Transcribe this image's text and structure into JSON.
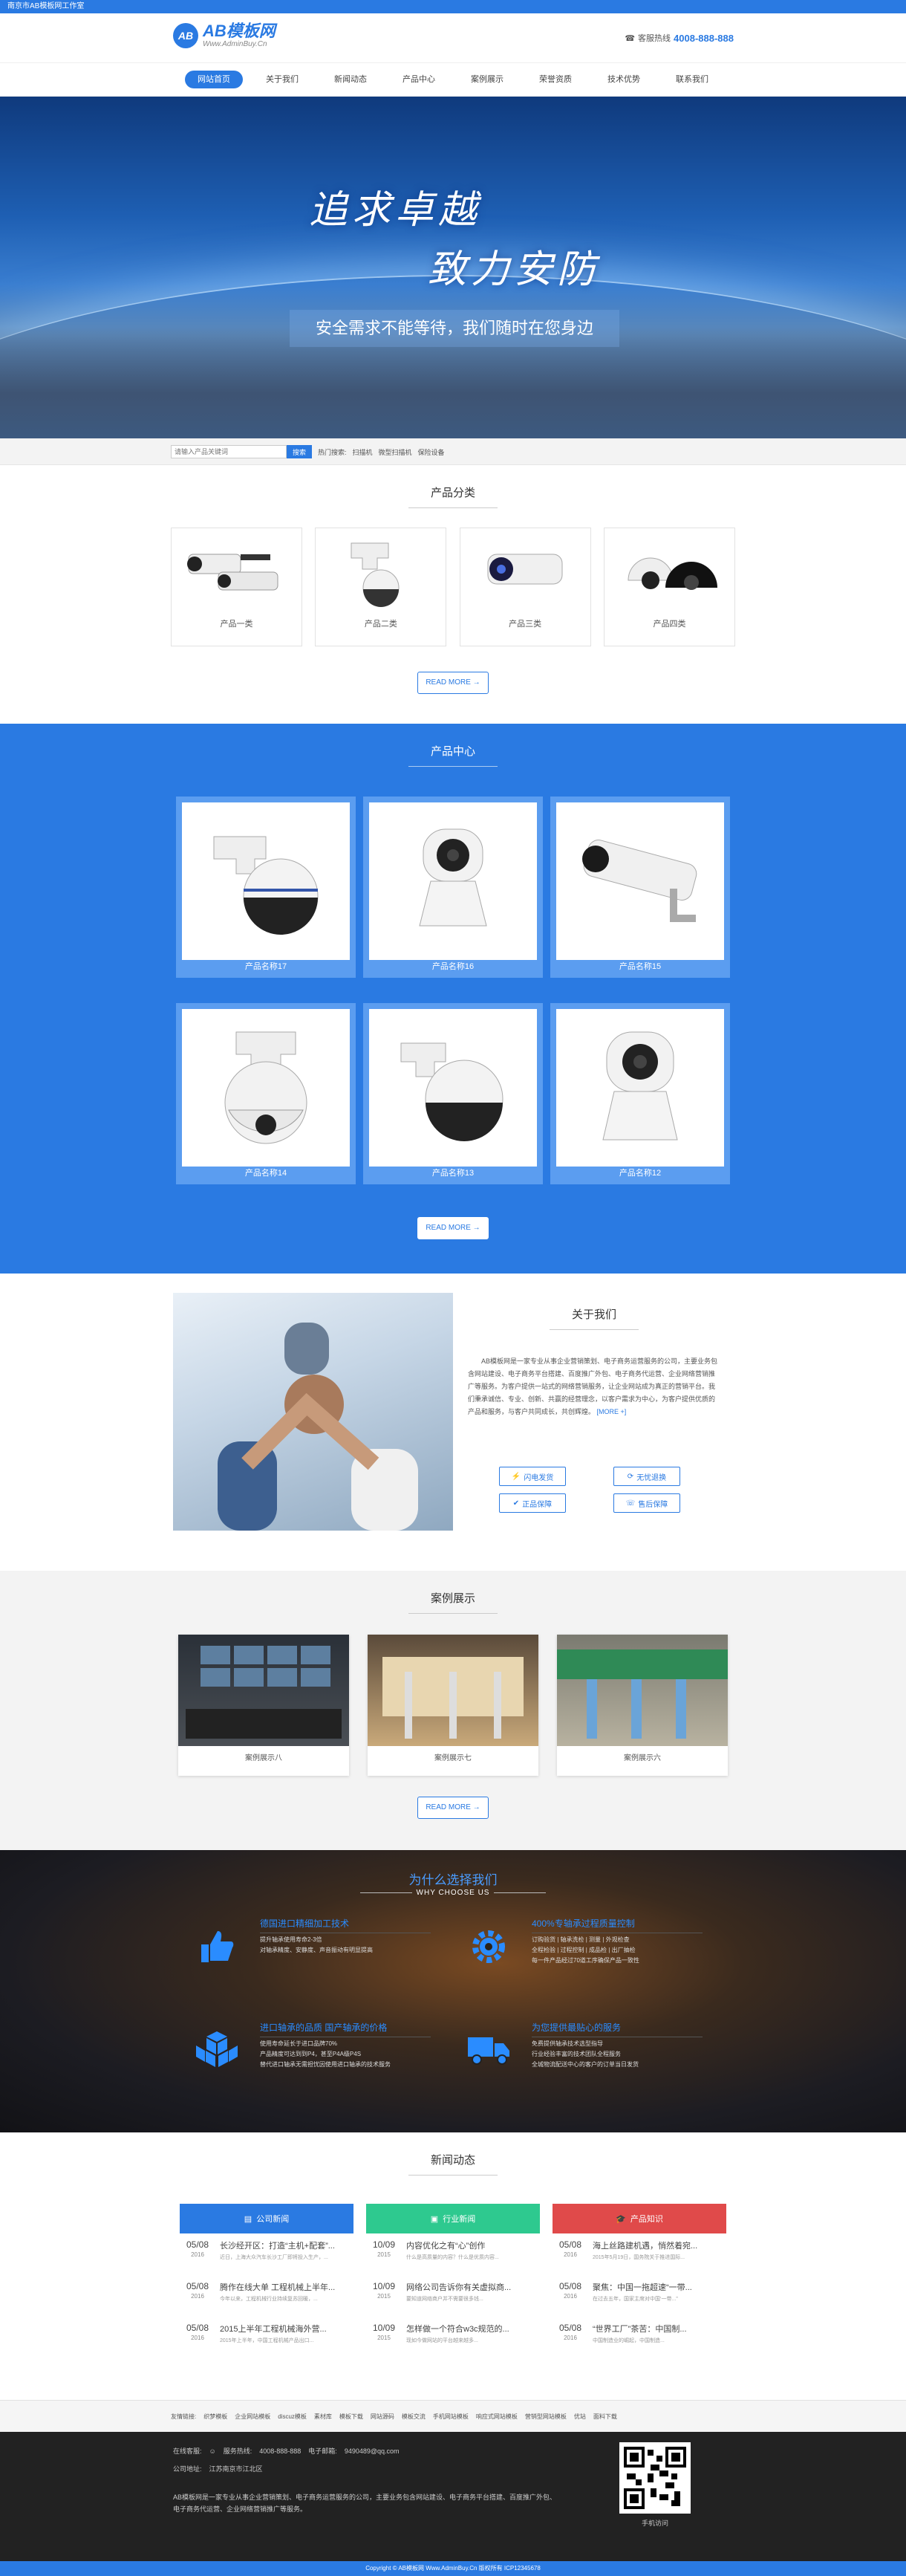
{
  "topbar": {
    "text": "南京市AB模板网工作室"
  },
  "header": {
    "logo_mark": "AB",
    "logo_title": "AB模板网",
    "logo_sub": "Www.AdminBuy.Cn",
    "hotline_label": "客服热线",
    "hotline_number": "4008-888-888"
  },
  "nav": {
    "items": [
      "网站首页",
      "关于我们",
      "新闻动态",
      "产品中心",
      "案例展示",
      "荣誉资质",
      "技术优势",
      "联系我们"
    ]
  },
  "banner": {
    "slogan1": "追求卓越",
    "slogan2": "致力安防",
    "subtitle": "安全需求不能等待，我们随时在您身边"
  },
  "search": {
    "placeholder": "请输入产品关键词",
    "button": "搜索",
    "hot_label": "热门搜索:",
    "hot": [
      "扫描机",
      "微型扫描机",
      "保险设备"
    ]
  },
  "categories": {
    "title": "产品分类",
    "items": [
      "产品一类",
      "产品二类",
      "产品三类",
      "产品四类"
    ],
    "more": "READ MORE →"
  },
  "products": {
    "title": "产品中心",
    "items": [
      "产品名称17",
      "产品名称16",
      "产品名称15",
      "产品名称14",
      "产品名称13",
      "产品名称12"
    ],
    "more": "READ MORE →"
  },
  "about": {
    "title": "关于我们",
    "text": "AB模板网是一家专业从事企业营销策划、电子商务运营服务的公司，主要业务包含网站建设、电子商务平台搭建、百度推广外包、电子商务代运营、企业网络营销推广等服务。为客户提供一站式的网络营销服务，让企业网站成为真正的营销平台。我们秉承诚信、专业、创新、共赢的经营理念，以客户需求为中心，为客户提供优质的产品和服务，与客户共同成长，共创辉煌。",
    "more": "[MORE +]",
    "features": [
      "闪电发货",
      "无忧退换",
      "正品保障",
      "售后保障"
    ]
  },
  "cases": {
    "title": "案例展示",
    "items": [
      "案例展示八",
      "案例展示七",
      "案例展示六"
    ],
    "more": "READ MORE →"
  },
  "why": {
    "title": "为什么选择我们",
    "subtitle": "WHY CHOOSE US",
    "items": [
      {
        "t": "德国进口精细加工技术",
        "d": "提升轴承使用寿命2-3倍\n对轴承精度、安静度、声音振动有明显提高"
      },
      {
        "t": "400%专轴承过程质量控制",
        "d": "订购验货 | 轴承洗检 | 测量 | 外观检查\n全程检验 | 过程控制 | 成品检 | 出厂抽检\n每一件产品经过70道工序确保产品一致性"
      },
      {
        "t": "进口轴承的品质 国产轴承的价格",
        "d": "使用寿命延长于进口品牌70%\n产品精度可达到到P4，甚至P4A级P4S\n替代进口轴承无需担忧因使用进口轴承的技术服务"
      },
      {
        "t": "为您提供最贴心的服务",
        "d": "免费提供轴承技术选型指导\n行业经验丰富的技术团队全程服务\n全城物流配送中心的客户的订单当日发货"
      }
    ]
  },
  "news": {
    "title": "新闻动态",
    "cols": [
      {
        "head": "公司新闻",
        "color": "#2a7ae2",
        "items": [
          {
            "day": "05/08",
            "year": "2016",
            "t": "长沙经开区：打造“主机+配套”...",
            "d": "近日，上海大众汽车长沙工厂即将投入生产，..."
          },
          {
            "day": "05/08",
            "year": "2016",
            "t": "腾作在线大单 工程机械上半年...",
            "d": "今年以来，工程机械行业持续复苏回暖，..."
          },
          {
            "day": "05/08",
            "year": "2016",
            "t": "2015上半年工程机械海外营...",
            "d": "2015年上半年，中国工程机械产品出口..."
          }
        ]
      },
      {
        "head": "行业新闻",
        "color": "#2ec98f",
        "items": [
          {
            "day": "10/09",
            "year": "2015",
            "t": "内容优化之有“心”创作",
            "d": "什么是高质量的内容？什么是优质内容..."
          },
          {
            "day": "10/09",
            "year": "2015",
            "t": "网络公司告诉你有关虚拟商...",
            "d": "要知道网络商户并不需要很多钱..."
          },
          {
            "day": "10/09",
            "year": "2015",
            "t": "怎样做一个符合w3c规范的...",
            "d": "现如今做网站的平台越来越多..."
          }
        ]
      },
      {
        "head": "产品知识",
        "color": "#e04a4a",
        "items": [
          {
            "day": "05/08",
            "year": "2016",
            "t": "海上丝路建机遇，悄然着宛...",
            "d": "2015年5月19日，国务院关于推进国际..."
          },
          {
            "day": "05/08",
            "year": "2016",
            "t": "聚焦：中国一拖超速“一带...",
            "d": "在过去五年，国家主席对中国‘一带...”"
          },
          {
            "day": "05/08",
            "year": "2016",
            "t": "“世界工厂”茶苦：中国制...",
            "d": "中国制造业的崛起，中国制造..."
          }
        ]
      }
    ]
  },
  "links": {
    "label": "友情链接:",
    "items": [
      "织梦模板",
      "企业网站模板",
      "discuz模板",
      "素材库",
      "模板下载",
      "网站源码",
      "模板交流",
      "手机网站模板",
      "响应式网站模板",
      "营销型网站模板",
      "优站",
      "面料下载"
    ]
  },
  "footer": {
    "contact_label": "在线客服:",
    "phone_label": "服务热线:",
    "phone": "4008-888-888",
    "email_label": "电子邮箱:",
    "email": "9490489@qq.com",
    "address_label": "公司地址:",
    "address": "江苏南京市江北区",
    "intro": "AB模板网是一家专业从事企业营销策划、电子商务运营服务的公司，主要业务包含网站建设、电子商务平台搭建、百度推广外包、电子商务代运营、企业网络营销推广等服务。",
    "qr_label": "手机访问"
  },
  "copyright": "Copyright © AB模板网 Www.AdminBuy.Cn 版权所有  ICP12345678"
}
